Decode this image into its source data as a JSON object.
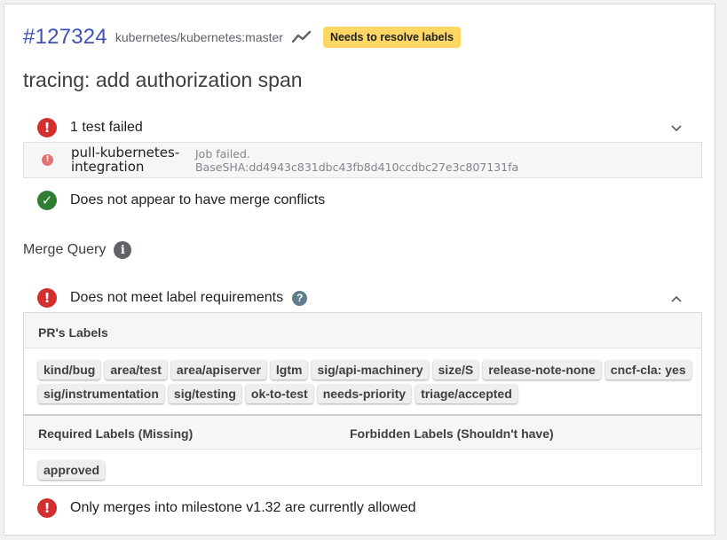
{
  "pr": {
    "number": "#127324",
    "repo": "kubernetes/kubernetes:master",
    "badge": "Needs to resolve labels",
    "title": "tracing: add authorization span"
  },
  "tests": {
    "summary": "1 test failed",
    "job_name": "pull-kubernetes-integration",
    "job_status": "Job failed.",
    "job_sha": "BaseSHA:dd4943c831dbc43fb8d410ccdbc27e3c807131fa"
  },
  "merge_conflicts": {
    "text": "Does not appear to have merge conflicts"
  },
  "merge_query": {
    "label": "Merge Query",
    "info_glyph": "i"
  },
  "label_requirements": {
    "text": "Does not meet label requirements",
    "help_glyph": "?",
    "pr_labels_title": "PR's Labels",
    "pr_labels": [
      "kind/bug",
      "area/test",
      "area/apiserver",
      "lgtm",
      "sig/api-machinery",
      "size/S",
      "release-note-none",
      "cncf-cla: yes",
      "sig/instrumentation",
      "sig/testing",
      "ok-to-test",
      "needs-priority",
      "triage/accepted"
    ],
    "required_title": "Required Labels (Missing)",
    "forbidden_title": "Forbidden Labels (Shouldn't have)",
    "required_missing": [
      "approved"
    ]
  },
  "milestone": {
    "text": "Only merges into milestone v1.32 are currently allowed"
  },
  "icons": {
    "error": "!",
    "ok": "✓"
  },
  "colors": {
    "pr_number": "#3f51b5",
    "badge_bg": "#fdd663",
    "error": "#d32f2f",
    "success": "#2e7d32"
  }
}
